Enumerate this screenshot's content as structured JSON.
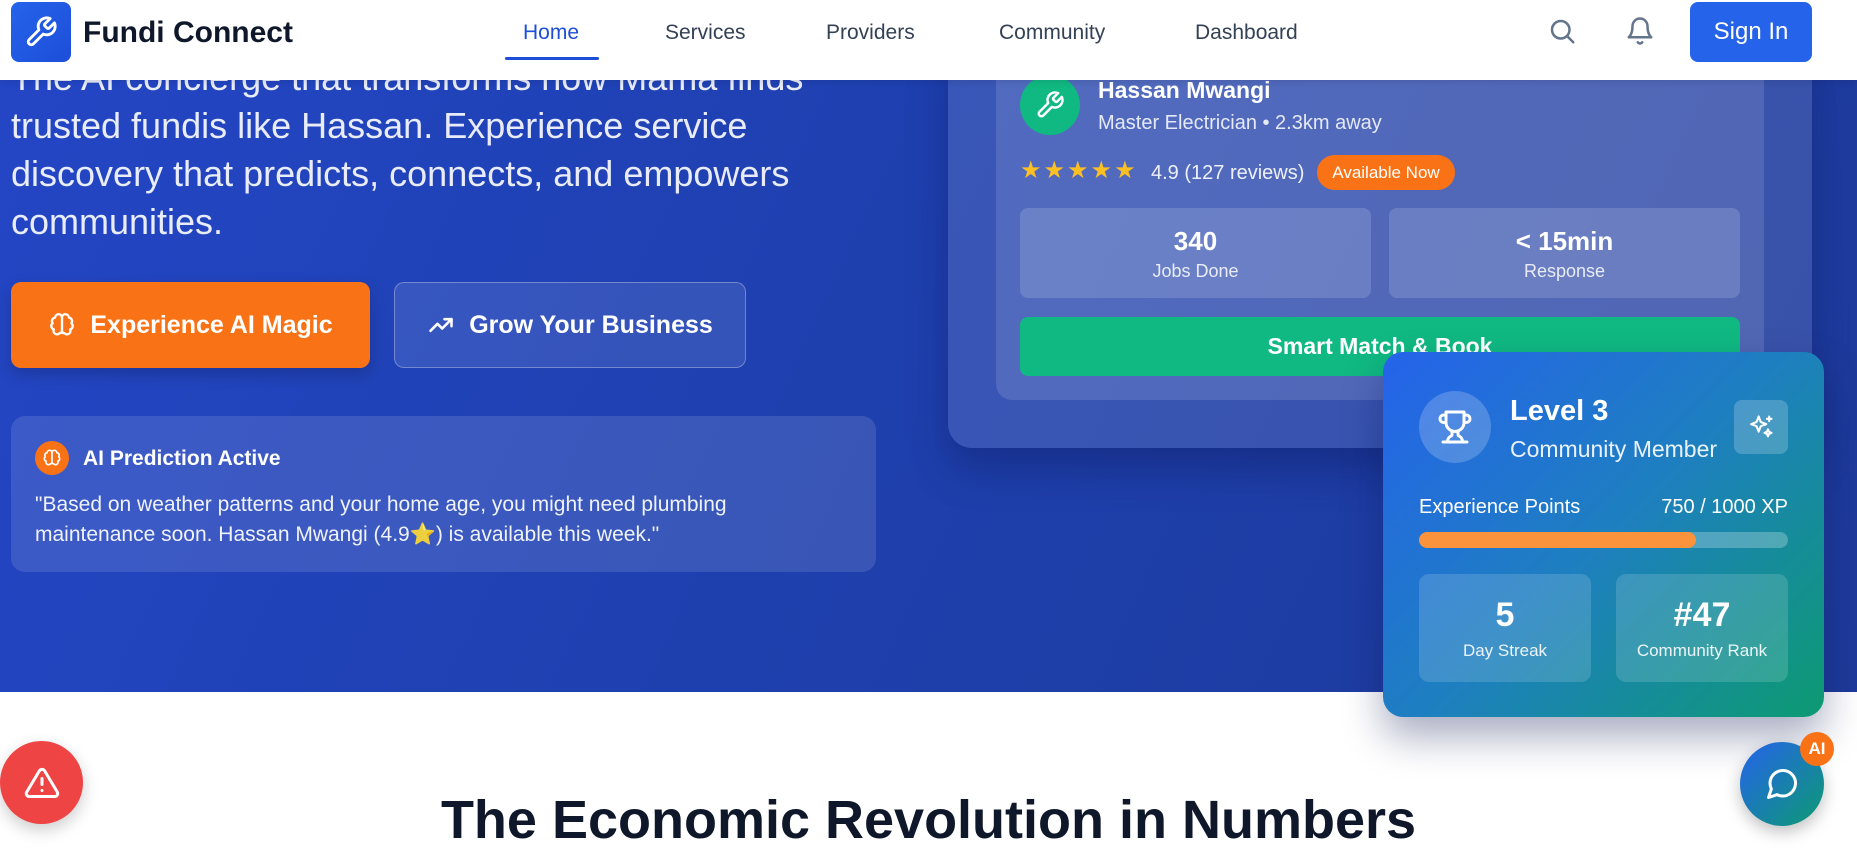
{
  "colors": {
    "primary": "#2563eb",
    "accent_orange": "#f97316",
    "accent_green": "#10b981",
    "hero_bg": "#1e40af",
    "danger": "#ef4444"
  },
  "header": {
    "brand": "Fundi Connect",
    "logo_icon": "wrench-icon",
    "nav": [
      "Home",
      "Services",
      "Providers",
      "Community",
      "Dashboard"
    ],
    "active_nav": "Home",
    "search_icon": "search-icon",
    "notifications_icon": "bell-icon",
    "sign_in": "Sign In"
  },
  "hero": {
    "lines": [
      "The AI concierge that transforms how Mama finds",
      "trusted fundis like Hassan. Experience service",
      "discovery that predicts, connects, and empowers",
      "communities."
    ],
    "primary_cta": "Experience AI Magic",
    "primary_cta_icon": "brain-icon",
    "secondary_cta": "Grow Your Business",
    "secondary_cta_icon": "trending-up-icon",
    "ai_prediction": {
      "title": "AI Prediction Active",
      "text": "\"Based on weather patterns and your home age, you might need plumbing maintenance soon. Hassan Mwangi (4.9⭐) is available this week.\""
    }
  },
  "provider_card": {
    "name": "Hassan Mwangi",
    "subtitle": "Master Electrician • 2.3km away",
    "stars": 5,
    "rating_text": "4.9 (127 reviews)",
    "badge": "Available Now",
    "stats": [
      {
        "value": "340",
        "label": "Jobs Done"
      },
      {
        "value": "< 15min",
        "label": "Response"
      }
    ],
    "button": "Smart Match & Book"
  },
  "level_card": {
    "title": "Level 3",
    "subtitle": "Community Member",
    "xp_label": "Experience Points",
    "xp_value": "750 / 1000 XP",
    "xp_fraction": 0.75,
    "stats": [
      {
        "value": "5",
        "label": "Day Streak"
      },
      {
        "value": "#47",
        "label": "Community Rank"
      }
    ]
  },
  "section": {
    "title": "The Economic Revolution in Numbers"
  },
  "fab": {
    "alert_icon": "alert-triangle-icon",
    "chat_icon": "chat-icon",
    "chat_badge": "AI"
  }
}
